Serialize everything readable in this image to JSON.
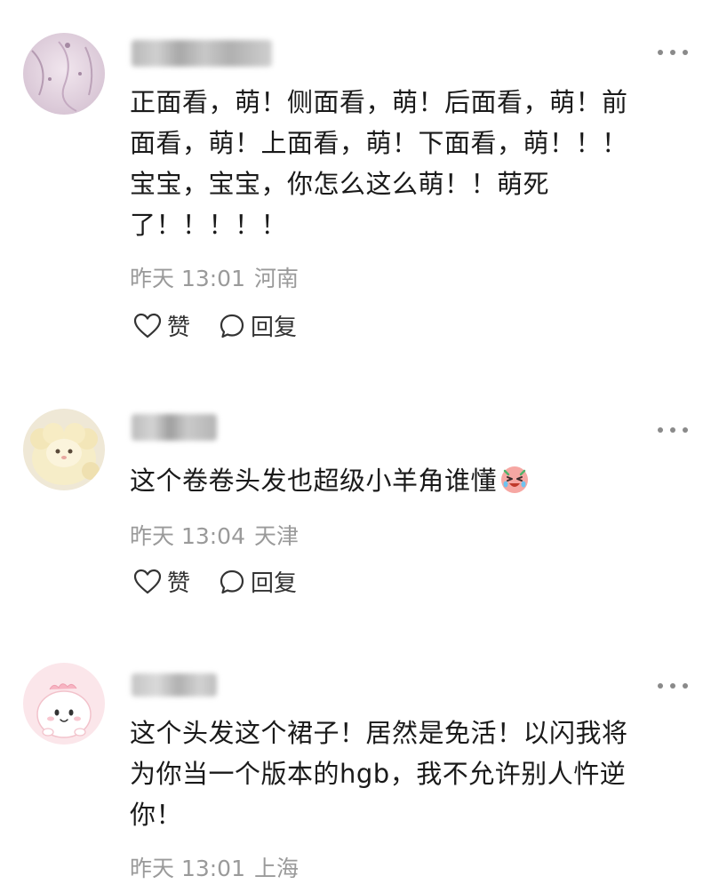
{
  "comments": [
    {
      "avatar": "lace-dress-avatar",
      "username_blurred": true,
      "text": "正面看，萌！侧面看，萌！后面看，萌！前面看，萌！上面看，萌！下面看，萌！！！宝宝，宝宝，你怎么这么萌！！萌死了！！！！！",
      "lines": [
        "正面看，萌！侧面看，萌！后面看，萌！前",
        "面看，萌！上面看，萌！下面看，萌！！！",
        "宝宝，宝宝，你怎么这么萌！！萌死",
        "了！！！！！"
      ],
      "time": "昨天 13:01",
      "location": "河南",
      "like_label": "赞",
      "reply_label": "回复"
    },
    {
      "avatar": "plush-sheep-avatar",
      "username_blurred": true,
      "text": "这个卷卷头发也超级小羊角谁懂",
      "lines": [
        "这个卷卷头发也超级小羊角谁懂"
      ],
      "emoji": "laughing-tears-emoji",
      "time": "昨天 13:04",
      "location": "天津",
      "like_label": "赞",
      "reply_label": "回复"
    },
    {
      "avatar": "pink-cartoon-avatar",
      "username_blurred": true,
      "text": "这个头发这个裙子！居然是免活！以闪我将为你当一个版本的hgb，我不允许别人忤逆你！",
      "lines": [
        "这个头发这个裙子！居然是免活！以闪我将",
        "为你当一个版本的hgb，我不允许别人忤逆",
        "你！"
      ],
      "time": "昨天 13:01",
      "location": "上海"
    }
  ],
  "colors": {
    "text": "#1a1a1a",
    "meta": "#9a9a9a",
    "icon": "#333333"
  }
}
